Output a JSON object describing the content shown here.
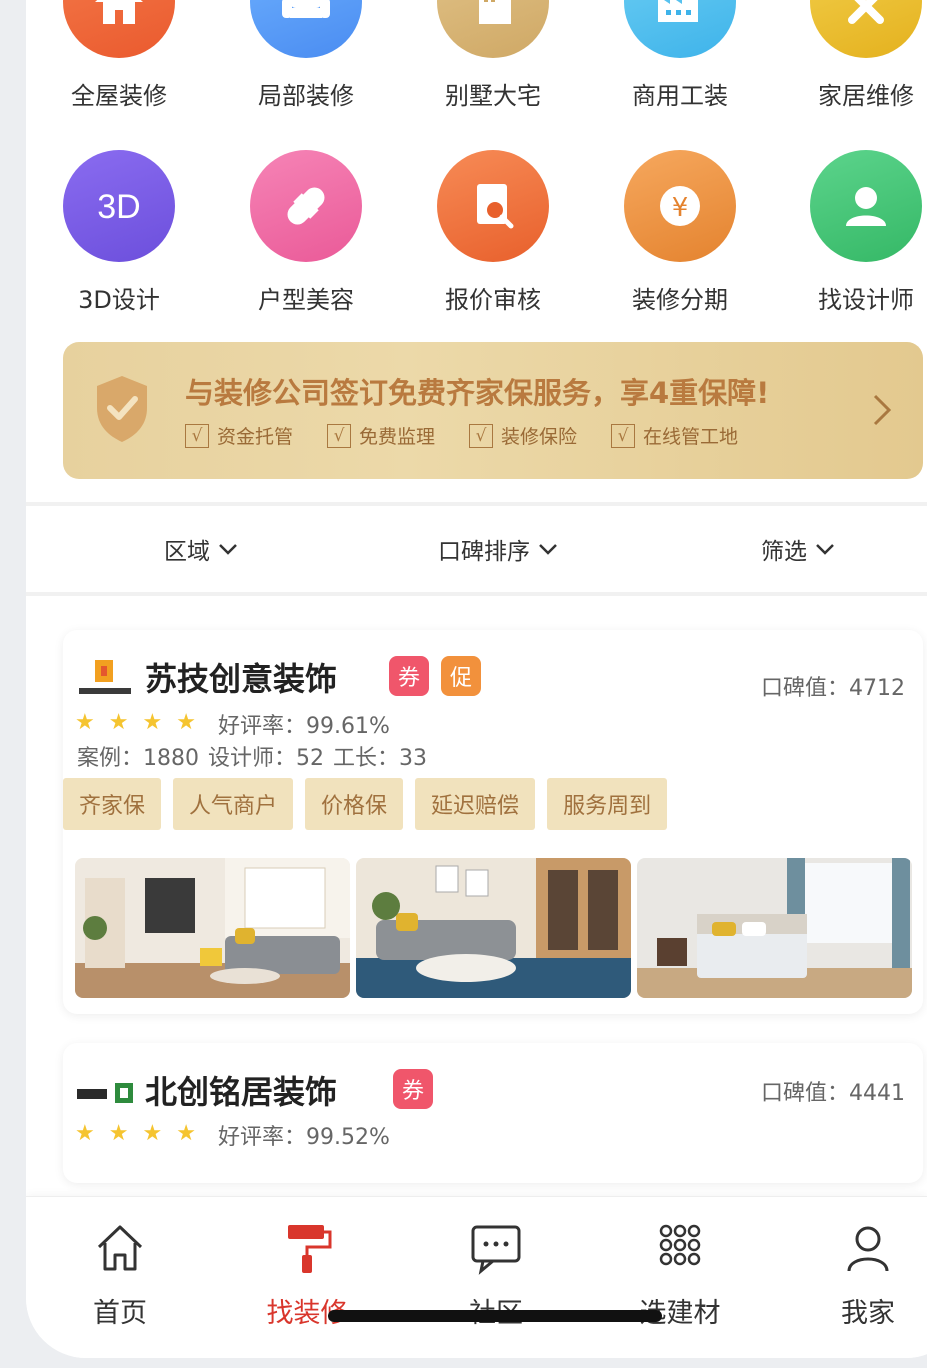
{
  "categories": [
    {
      "label": "全屋装修",
      "icon": "house-icon"
    },
    {
      "label": "局部装修",
      "icon": "armchair-icon"
    },
    {
      "label": "别墅大宅",
      "icon": "villa-building-icon"
    },
    {
      "label": "商用工装",
      "icon": "factory-icon"
    },
    {
      "label": "家居维修",
      "icon": "hammer-wrench-icon"
    },
    {
      "label": "3D设计",
      "icon": "3d-icon"
    },
    {
      "label": "户型美容",
      "icon": "bandage-icon"
    },
    {
      "label": "报价审核",
      "icon": "document-search-icon"
    },
    {
      "label": "装修分期",
      "icon": "yen-coin-icon"
    },
    {
      "label": "找设计师",
      "icon": "person-icon"
    }
  ],
  "banner": {
    "title": "与装修公司签订免费齐家保服务，享4重保障!",
    "checkmark": "√",
    "checks": [
      "资金托管",
      "免费监理",
      "装修保险",
      "在线管工地"
    ]
  },
  "filters": [
    "区域",
    "口碑排序",
    "筛选"
  ],
  "companies": [
    {
      "name": "苏技创意装饰",
      "badges": [
        "券",
        "促"
      ],
      "reputation": "口碑值：4712",
      "star": "★",
      "rating": "好评率：99.61%",
      "stats": "案例：1880  设计师：52  工长：33",
      "tags": [
        "齐家保",
        "人气商户",
        "价格保",
        "延迟赔偿",
        "服务周到"
      ]
    },
    {
      "name": "北创铭居装饰",
      "badges": [
        "券"
      ],
      "reputation": "口碑值：4441",
      "star": "★",
      "rating": "好评率：99.52%"
    }
  ],
  "tabbar": [
    {
      "label": "首页",
      "icon": "home-icon",
      "active": false
    },
    {
      "label": "找装修",
      "icon": "paint-roller-icon",
      "active": true
    },
    {
      "label": "社区",
      "icon": "chat-icon",
      "active": false
    },
    {
      "label": "选建材",
      "icon": "grid-dots-icon",
      "active": false
    },
    {
      "label": "我家",
      "icon": "user-icon",
      "active": false
    }
  ],
  "colors": {
    "accent": "#d9362c",
    "banner_text": "#b97a3f",
    "tag_bg": "#f1e2bd",
    "tag_text": "#a0713e",
    "coupon": "#f0566b",
    "promo": "#f2913c"
  }
}
